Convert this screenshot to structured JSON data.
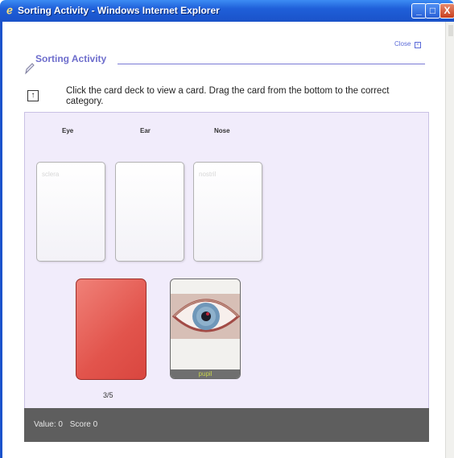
{
  "window": {
    "title": "Sorting Activity - Windows Internet Explorer",
    "controls": {
      "minimize": "_",
      "maximize": "□",
      "close": "X"
    }
  },
  "close_link": {
    "label": "Close",
    "icon": "close-box-icon"
  },
  "activity": {
    "heading": "Sorting Activity",
    "instruction": "Click the card deck to view a card. Drag the card from the bottom to the correct category."
  },
  "categories": [
    {
      "label": "Eye",
      "placed_card": "sclera"
    },
    {
      "label": "Ear",
      "placed_card": ""
    },
    {
      "label": "Nose",
      "placed_card": "nostril"
    }
  ],
  "deck": {
    "count": "3/5",
    "color": "#e2544c"
  },
  "current_card": {
    "label": "pupil",
    "image": "eye-icon"
  },
  "status": {
    "value_label": "Value: 0",
    "score_label": "Score 0"
  },
  "colors": {
    "titlebar": "#1f5fd9",
    "panel": "#f1ecfb",
    "heading": "#6d6dcc",
    "status_bar": "#5e5e5e"
  }
}
